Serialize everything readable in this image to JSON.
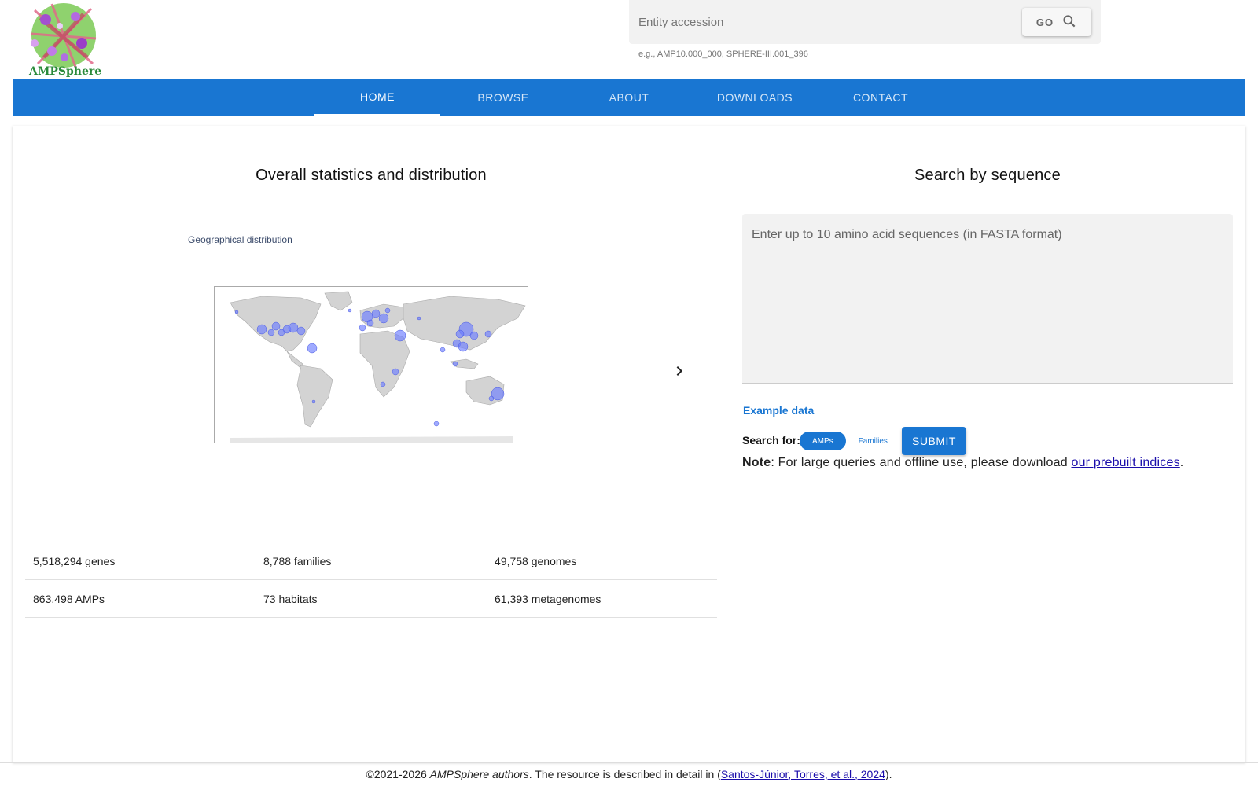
{
  "brand": {
    "name": "AMPSphere"
  },
  "search": {
    "placeholder": "Entity accession",
    "go_label": "GO",
    "hint": "e.g., AMP10.000_000, SPHERE-III.001_396"
  },
  "nav": {
    "tabs": [
      {
        "label": "HOME",
        "active": true
      },
      {
        "label": "BROWSE",
        "active": false
      },
      {
        "label": "ABOUT",
        "active": false
      },
      {
        "label": "DOWNLOADS",
        "active": false
      },
      {
        "label": "CONTACT",
        "active": false
      }
    ]
  },
  "stats": {
    "title": "Overall statistics and distribution",
    "map_caption": "Geographical distribution",
    "rows": [
      [
        "5,518,294 genes",
        "8,788 families",
        "49,758 genomes"
      ],
      [
        "863,498 AMPs",
        "73 habitats",
        "61,393 metagenomes"
      ]
    ]
  },
  "sequence_search": {
    "title": "Search by sequence",
    "placeholder": "Enter up to 10 amino acid sequences (in FASTA format)",
    "example_label": "Example data",
    "search_for_label": "Search for:",
    "toggle_options": [
      "AMPs",
      "Families"
    ],
    "selected_option": "AMPs",
    "submit_label": "SUBMIT",
    "note_label": "Note",
    "note_text": ": For large queries and offline use, please download ",
    "note_link": "our prebuilt indices",
    "note_end": "."
  },
  "footer": {
    "prefix": "©2021-2026 ",
    "authors": "AMPSphere authors",
    "middle": ". The resource is described in detail in (",
    "citation": "Santos-Júnior, Torres, et al., 2024",
    "suffix": ")."
  },
  "colors": {
    "primary": "#1976d2",
    "map_land": "#d3d3d3",
    "map_points": "#6b7cff",
    "link": "#1a0dab"
  },
  "icons": {
    "go": "search-icon",
    "carousel": "chevron-right-icon"
  }
}
